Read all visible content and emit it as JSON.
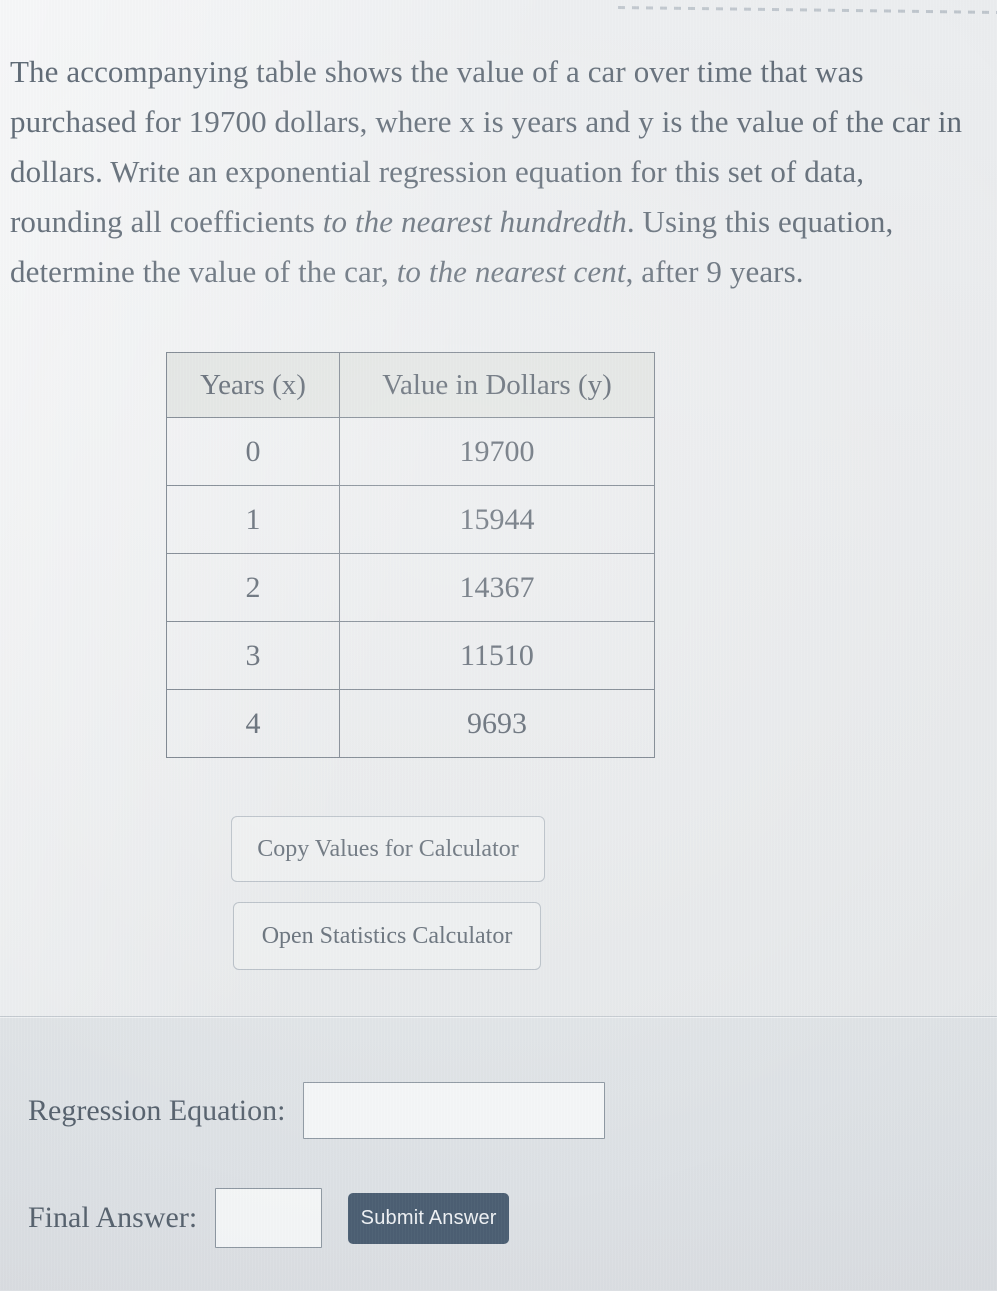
{
  "question": {
    "part1": "The accompanying table shows the value of a car over time that was purchased for 19700 dollars, where x is years and y is the value of the car in dollars. Write an exponential regression equation for this set of data, rounding all coefficients ",
    "italic1": "to the nearest hundredth",
    "part2": ". Using this equation, determine the value of the car, ",
    "italic2": "to the nearest cent",
    "part3": ", after 9 years."
  },
  "table": {
    "headers": [
      "Years (x)",
      "Value in Dollars (y)"
    ],
    "rows": [
      {
        "x": "0",
        "y": "19700"
      },
      {
        "x": "1",
        "y": "15944"
      },
      {
        "x": "2",
        "y": "14367"
      },
      {
        "x": "3",
        "y": "11510"
      },
      {
        "x": "4",
        "y": "9693"
      }
    ]
  },
  "buttons": {
    "copy_values": "Copy Values for Calculator",
    "open_calculator": "Open Statistics Calculator",
    "submit": "Submit Answer"
  },
  "answer_panel": {
    "regression_label": "Regression Equation:",
    "regression_value": "",
    "final_label": "Final Answer:",
    "final_value": ""
  },
  "colors": {
    "page_background": "#e8eaec",
    "answer_panel_background": "#dde1e5",
    "text": "#5b6672",
    "table_border": "#6d7782",
    "table_header_fill": "#dfe2e0",
    "submit_button": "#4c5f73",
    "input_border": "#8d97a1"
  }
}
